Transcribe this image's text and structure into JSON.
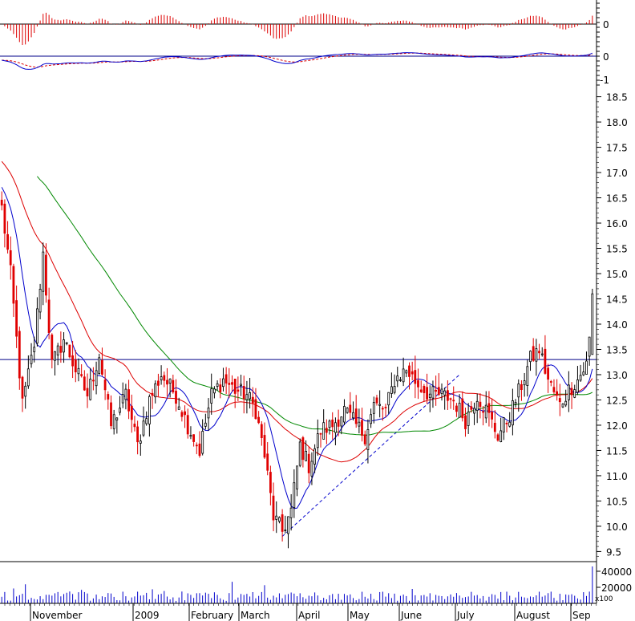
{
  "chart_data": {
    "type": "candlestick",
    "colors": {
      "up": "#000000",
      "down": "#e00000",
      "ma_short": "#0000cc",
      "ma_mid": "#dd0000",
      "ma_long": "#008800",
      "volume": "#0000cc",
      "histogram": "#dd0000",
      "macd_line": "#0000cc",
      "signal_line": "#dd0000",
      "trendline": "#0000cc"
    },
    "panels": {
      "histogram": {
        "yticks": [
          "0"
        ]
      },
      "macd": {
        "yticks": [
          "0",
          "-1"
        ]
      },
      "volume": {
        "yticks": [
          "40000",
          "20000"
        ],
        "multiplier_label": "x100"
      }
    },
    "price_axis": {
      "ylim": [
        9.3,
        18.7
      ],
      "ticks": [
        "9.5",
        "10.0",
        "10.5",
        "11.0",
        "11.5",
        "12.0",
        "12.5",
        "13.0",
        "13.5",
        "14.0",
        "14.5",
        "15.0",
        "15.5",
        "16.0",
        "16.5",
        "17.0",
        "17.5",
        "18.0",
        "18.5"
      ]
    },
    "x_labels": [
      "November",
      "2009",
      "February",
      "March",
      "April",
      "May",
      "June",
      "July",
      "August",
      "Sep"
    ],
    "resistance_level": 13.3,
    "trendline": {
      "from": [
        9.8,
        "early March"
      ],
      "to": [
        13.0,
        "mid June"
      ]
    },
    "close_anchors": [
      [
        0,
        16.3
      ],
      [
        3,
        15.0
      ],
      [
        7,
        12.4
      ],
      [
        11,
        13.6
      ],
      [
        14,
        15.4
      ],
      [
        17,
        13.2
      ],
      [
        21,
        13.7
      ],
      [
        25,
        13.1
      ],
      [
        29,
        12.6
      ],
      [
        33,
        13.4
      ],
      [
        37,
        12.0
      ],
      [
        42,
        12.6
      ],
      [
        46,
        11.6
      ],
      [
        50,
        12.5
      ],
      [
        54,
        13.0
      ],
      [
        59,
        12.6
      ],
      [
        63,
        12.0
      ],
      [
        67,
        11.5
      ],
      [
        71,
        12.6
      ],
      [
        75,
        12.9
      ],
      [
        79,
        12.7
      ],
      [
        83,
        12.6
      ],
      [
        86,
        12.3
      ],
      [
        89,
        11.4
      ],
      [
        92,
        10.2
      ],
      [
        95,
        9.9
      ],
      [
        98,
        10.3
      ],
      [
        101,
        11.6
      ],
      [
        104,
        11.2
      ],
      [
        108,
        11.9
      ],
      [
        112,
        12.0
      ],
      [
        116,
        12.3
      ],
      [
        120,
        12.0
      ],
      [
        123,
        11.8
      ],
      [
        126,
        12.4
      ],
      [
        130,
        12.3
      ],
      [
        133,
        12.9
      ],
      [
        137,
        13.1
      ],
      [
        141,
        12.8
      ],
      [
        145,
        12.6
      ],
      [
        149,
        12.6
      ],
      [
        153,
        12.5
      ],
      [
        157,
        12.1
      ],
      [
        161,
        12.6
      ],
      [
        164,
        12.3
      ],
      [
        168,
        11.8
      ],
      [
        172,
        12.2
      ],
      [
        176,
        12.8
      ],
      [
        179,
        13.3
      ],
      [
        182,
        13.5
      ],
      [
        185,
        12.9
      ],
      [
        189,
        12.4
      ],
      [
        192,
        12.7
      ],
      [
        195,
        12.9
      ],
      [
        198,
        13.2
      ],
      [
        200,
        14.2
      ]
    ],
    "last_candle": {
      "open": 13.4,
      "high": 14.7,
      "low": 13.4,
      "close": 14.6,
      "volume": 46000
    },
    "ma_short_period": 10,
    "ma_mid_period": 30,
    "ma_long_period": 60
  }
}
